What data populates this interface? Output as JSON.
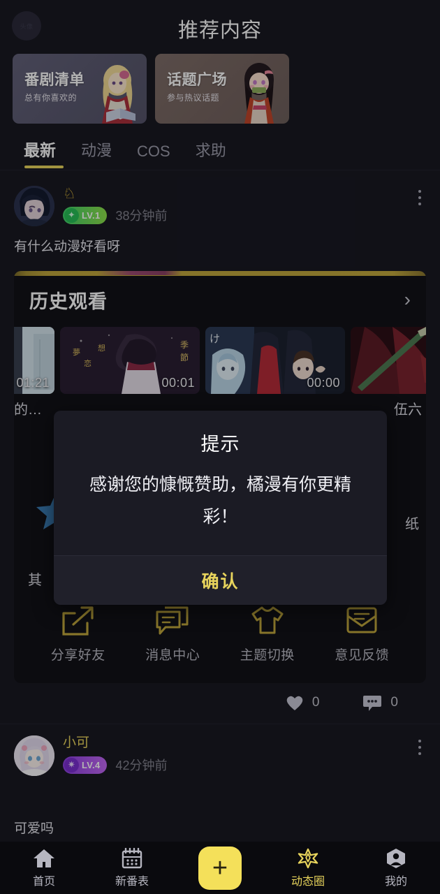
{
  "header": {
    "title": "推荐内容",
    "avatar_placeholder": "头像"
  },
  "banners": [
    {
      "title": "番剧清单",
      "subtitle": "总有你喜欢的",
      "color": "#5d5c72",
      "art": "blonde-girl-reading"
    },
    {
      "title": "话题广场",
      "subtitle": "参与热议话题",
      "color": "#776763",
      "art": "nezuko-girl"
    }
  ],
  "tabs": {
    "items": [
      {
        "label": "最新",
        "active": true
      },
      {
        "label": "动漫",
        "active": false
      },
      {
        "label": "COS",
        "active": false
      },
      {
        "label": "求助",
        "active": false
      }
    ],
    "indicator_color": "#e8d45c"
  },
  "feed": {
    "posts": [
      {
        "username": "♘",
        "level": "LV.1",
        "level_color": "#5fd45a",
        "time": "38分钟前",
        "text": "有什么动漫好看呀",
        "likes": "0",
        "comments": "0",
        "embed": {
          "title": "历史观看",
          "chevron": "›",
          "thumbs": [
            {
              "time": "01:21",
              "caption": "的…"
            },
            {
              "time": "00:01",
              "caption": ""
            },
            {
              "time": "00:00",
              "caption": ""
            },
            {
              "time": "",
              "caption": "伍六"
            }
          ],
          "captions_left": "的…",
          "captions_right": "伍六",
          "mid_left": "其",
          "mid_right": "纸",
          "menu": [
            {
              "label": "分享好友",
              "icon": "share-icon"
            },
            {
              "label": "消息中心",
              "icon": "message-icon"
            },
            {
              "label": "主题切换",
              "icon": "tshirt-icon"
            },
            {
              "label": "意见反馈",
              "icon": "envelope-icon"
            }
          ],
          "accent_color": "#c2a83d"
        }
      },
      {
        "username": "小可",
        "level": "LV.4",
        "level_color": "#b05ef0",
        "time": "42分钟前",
        "text": "可爱吗"
      }
    ]
  },
  "dialog": {
    "title": "提示",
    "message": "感谢您的慷慨赞助，橘漫有你更精彩！",
    "confirm_label": "确认",
    "confirm_color": "#e8d45c"
  },
  "bottom_nav": {
    "items": [
      {
        "label": "首页",
        "icon": "home-icon",
        "active": false
      },
      {
        "label": "新番表",
        "icon": "calendar-icon",
        "active": false
      },
      {
        "label": "",
        "icon": "plus-icon",
        "active": false
      },
      {
        "label": "动态圈",
        "icon": "star-burst-icon",
        "active": true
      },
      {
        "label": "我的",
        "icon": "person-icon",
        "active": false
      }
    ],
    "accent_color": "#f4e05a"
  }
}
